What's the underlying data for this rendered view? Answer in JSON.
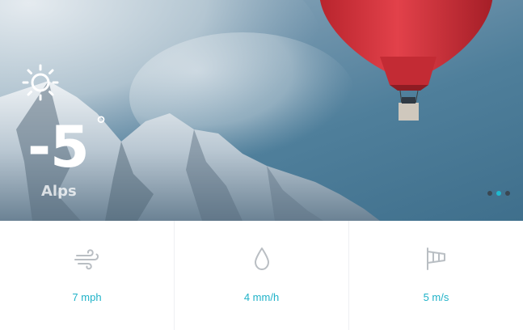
{
  "weather": {
    "temperature": "-5",
    "degree_symbol": "°",
    "location": "Alps",
    "condition_icon": "sun-icon"
  },
  "carousel": {
    "slide_count": 3,
    "active_index": 1
  },
  "stats": [
    {
      "icon": "wind-icon",
      "value": "7 mph"
    },
    {
      "icon": "drop-icon",
      "value": "4 mm/h"
    },
    {
      "icon": "windsock-icon",
      "value": "5 m/s"
    }
  ],
  "colors": {
    "accent": "#1fb9cf",
    "balloon": "#d8323b"
  }
}
